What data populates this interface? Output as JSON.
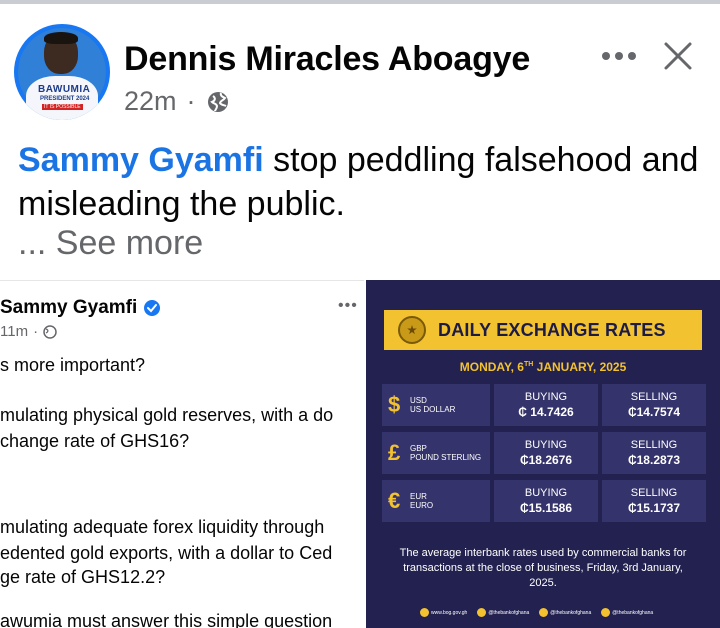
{
  "post": {
    "author": "Dennis Miracles Aboagye",
    "time": "22m",
    "separator": "·",
    "mention": "Sammy Gyamfi",
    "text_rest": " stop peddling falsehood and misleading the public.",
    "see_more": "... See more",
    "avatar_text": {
      "line1": "BAWUMIA",
      "line2": "PRESIDENT 2024",
      "line3": "IT IS POSSIBLE"
    }
  },
  "shared_left": {
    "name": "Sammy Gyamfi",
    "time": "11m",
    "separator": "·",
    "lines": [
      "s more important?",
      "mulating physical gold reserves, with a do",
      "change rate of GHS16?",
      "mulating adequate forex liquidity through",
      "edented gold exports, with a dollar to Ced",
      "ge rate of GHS12.2?",
      "awumia must answer this simple question"
    ]
  },
  "rates_card": {
    "title": "DAILY EXCHANGE RATES",
    "date_pre": "MONDAY, 6",
    "date_sup": "TH",
    "date_post": " JANUARY, 2025",
    "rows": [
      {
        "symbol": "$",
        "code": "USD",
        "name": "US DOLLAR",
        "buy_label": "BUYING",
        "buy": "₵ 14.7426",
        "sell_label": "SELLING",
        "sell": "₵14.7574"
      },
      {
        "symbol": "£",
        "code": "GBP",
        "name": "POUND STERLING",
        "buy_label": "BUYING",
        "buy": "₵18.2676",
        "sell_label": "SELLING",
        "sell": "₵18.2873"
      },
      {
        "symbol": "€",
        "code": "EUR",
        "name": "EURO",
        "buy_label": "BUYING",
        "buy": "₵15.1586",
        "sell_label": "SELLING",
        "sell": "₵15.1737"
      }
    ],
    "note": "The average interbank rates used by commercial banks for transactions at the close of business, Friday, 3rd January, 2025.",
    "footer": [
      "www.bog.gov.gh",
      "@thebankofghana",
      "@thebankofghana",
      "@thebankofghana"
    ]
  },
  "colors": {
    "mention": "#1b74e4",
    "card_bg": "#22214f",
    "card_accent": "#f2c230",
    "meta": "#65676b"
  },
  "icons": [
    "globe-icon",
    "more-options-icon",
    "close-icon",
    "verified-badge-icon",
    "bank-logo-icon"
  ]
}
